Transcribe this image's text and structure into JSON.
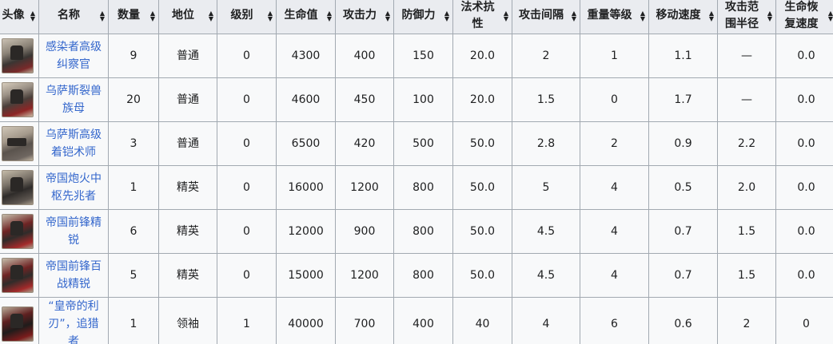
{
  "headers": [
    "头像",
    "名称",
    "数量",
    "地位",
    "级别",
    "生命值",
    "攻击力",
    "防御力",
    "法术抗性",
    "攻击间隔",
    "重量等级",
    "移动速度",
    "攻击范围半径",
    "生命恢复速度"
  ],
  "headers_display": [
    [
      "头像"
    ],
    [
      "名称"
    ],
    [
      "数量"
    ],
    [
      "地位"
    ],
    [
      "级别"
    ],
    [
      "生命值"
    ],
    [
      "攻击力"
    ],
    [
      "防御力"
    ],
    [
      "法术抗性"
    ],
    [
      "攻击间隔"
    ],
    [
      "重量等级"
    ],
    [
      "移动速度"
    ],
    [
      "攻击范",
      "围半径"
    ],
    [
      "生命恢",
      "复速度"
    ]
  ],
  "sort_icon": "sort-updown-icon",
  "rows": [
    {
      "avatar": "enemy-avatar",
      "name_lines": [
        "感染者高级",
        "纠察官"
      ],
      "count": "9",
      "status": "普通",
      "level": "0",
      "hp": "4300",
      "atk": "400",
      "def": "150",
      "res": "20.0",
      "interval": "2",
      "weight": "1",
      "speed": "1.1",
      "range": "—",
      "regen": "0.0"
    },
    {
      "avatar": "enemy-avatar",
      "name_lines": [
        "乌萨斯裂兽",
        "族母"
      ],
      "count": "20",
      "status": "普通",
      "level": "0",
      "hp": "4600",
      "atk": "450",
      "def": "100",
      "res": "20.0",
      "interval": "1.5",
      "weight": "0",
      "speed": "1.7",
      "range": "—",
      "regen": "0.0"
    },
    {
      "avatar": "enemy-avatar",
      "name_lines": [
        "乌萨斯高级",
        "着铠术师"
      ],
      "count": "3",
      "status": "普通",
      "level": "0",
      "hp": "6500",
      "atk": "420",
      "def": "500",
      "res": "50.0",
      "interval": "2.8",
      "weight": "2",
      "speed": "0.9",
      "range": "2.2",
      "regen": "0.0"
    },
    {
      "avatar": "enemy-avatar",
      "name_lines": [
        "帝国炮火中",
        "枢先兆者"
      ],
      "count": "1",
      "status": "精英",
      "level": "0",
      "hp": "16000",
      "atk": "1200",
      "def": "800",
      "res": "50.0",
      "interval": "5",
      "weight": "4",
      "speed": "0.5",
      "range": "2.0",
      "regen": "0.0"
    },
    {
      "avatar": "enemy-avatar",
      "name_lines": [
        "帝国前锋精",
        "锐"
      ],
      "count": "6",
      "status": "精英",
      "level": "0",
      "hp": "12000",
      "atk": "900",
      "def": "800",
      "res": "50.0",
      "interval": "4.5",
      "weight": "4",
      "speed": "0.7",
      "range": "1.5",
      "regen": "0.0"
    },
    {
      "avatar": "enemy-avatar",
      "name_lines": [
        "帝国前锋百",
        "战精锐"
      ],
      "count": "5",
      "status": "精英",
      "level": "0",
      "hp": "15000",
      "atk": "1200",
      "def": "800",
      "res": "50.0",
      "interval": "4.5",
      "weight": "4",
      "speed": "0.7",
      "range": "1.5",
      "regen": "0.0"
    },
    {
      "avatar": "enemy-avatar",
      "name_lines": [
        "“皇帝的利",
        "刃”，追猎",
        "者"
      ],
      "count": "1",
      "status": "领袖",
      "level": "1",
      "hp": "40000",
      "atk": "700",
      "def": "400",
      "res": "40",
      "interval": "4",
      "weight": "6",
      "speed": "0.6",
      "range": "2",
      "regen": "0"
    }
  ],
  "colors": {
    "link": "#3366cc",
    "header_bg": "#eaecf0",
    "cell_bg": "#f8f9fa",
    "border": "#a2a9b1"
  }
}
